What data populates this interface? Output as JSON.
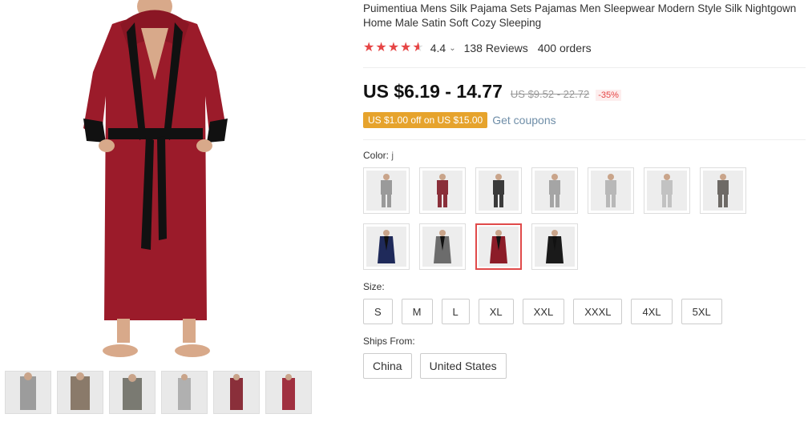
{
  "product": {
    "title": "Puimentiua Mens Silk Pajama Sets Pajamas Men Sleepwear Modern Style Silk Nightgown Home Male Satin Soft Cozy Sleeping",
    "rating": "4.4",
    "rating_stars": 4.5,
    "reviews": "138 Reviews",
    "orders": "400 orders"
  },
  "price": {
    "current": "US $6.19 - 14.77",
    "original": "US $9.52 - 22.72",
    "discount": "-35%"
  },
  "coupon": {
    "badge": "US $1.00 off on US $15.00",
    "link": "Get coupons"
  },
  "color": {
    "label": "Color:",
    "selected": "j",
    "swatches": [
      {
        "name": "gray-pajama",
        "color": "#9a9a9a",
        "selected": false
      },
      {
        "name": "maroon-pajama",
        "color": "#8a2f3a",
        "selected": false
      },
      {
        "name": "black-pajama",
        "color": "#3a3a3a",
        "selected": false
      },
      {
        "name": "gray-pajama-2",
        "color": "#a5a5a5",
        "selected": false
      },
      {
        "name": "silver-pajama",
        "color": "#b8b8b8",
        "selected": false
      },
      {
        "name": "light-gray-pajama",
        "color": "#c2c2c2",
        "selected": false
      },
      {
        "name": "lounge-photo",
        "color": "#6e6a66",
        "selected": false
      },
      {
        "name": "navy-robe",
        "color": "#1f2a5a",
        "selected": false
      },
      {
        "name": "gray-robe",
        "color": "#6c6c6c",
        "selected": false
      },
      {
        "name": "red-robe",
        "color": "#8c1c28",
        "selected": true
      },
      {
        "name": "black-robe",
        "color": "#1a1a1a",
        "selected": false
      }
    ]
  },
  "size": {
    "label": "Size:",
    "options": [
      "S",
      "M",
      "L",
      "XL",
      "XXL",
      "XXXL",
      "4XL",
      "5XL"
    ]
  },
  "ships": {
    "label": "Ships From:",
    "options": [
      "China",
      "United States"
    ]
  },
  "gallery": {
    "thumbnails": [
      {
        "name": "thumb-gray-lounging",
        "color": "#9c9c9c"
      },
      {
        "name": "thumb-patterned",
        "color": "#8a7a6a"
      },
      {
        "name": "thumb-camo",
        "color": "#7a7a72"
      },
      {
        "name": "thumb-light-gray",
        "color": "#b0b0b0"
      },
      {
        "name": "thumb-maroon",
        "color": "#8a2f3a"
      },
      {
        "name": "thumb-red",
        "color": "#a03040"
      }
    ]
  },
  "colors": {
    "accent_red": "#e64545",
    "coupon_orange": "#e6a32c",
    "robe_red": "#9b1b2a"
  }
}
